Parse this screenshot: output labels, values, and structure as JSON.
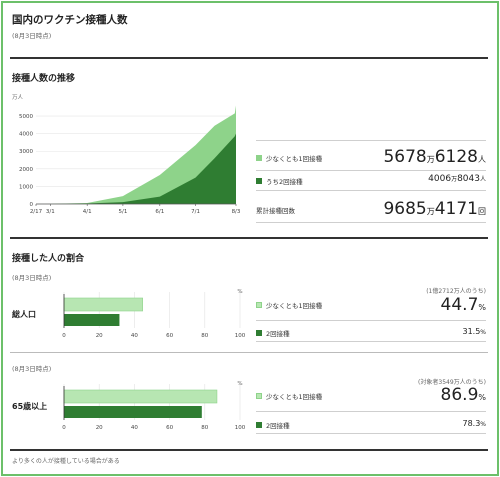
{
  "header": {
    "title": "国内のワクチン接種人数",
    "date": "(8月3日時点)"
  },
  "trend": {
    "title": "接種人数の推移",
    "y_unit": "万人",
    "at_least_one": {
      "label": "少なくとも1回接種",
      "num": "5678",
      "unit1": "万",
      "num2": "6128",
      "unit2": "人"
    },
    "second": {
      "label": "うち2回接種",
      "num": "4006",
      "unit1": "万",
      "num2": "8043",
      "unit2": "人"
    },
    "total": {
      "label": "累計接種回数",
      "num": "9685",
      "unit1": "万",
      "num2": "4171",
      "unit2": "回"
    }
  },
  "chart_data": {
    "type": "area",
    "x": [
      "2/17",
      "3/1",
      "4/1",
      "5/1",
      "6/1",
      "7/1",
      "8/3"
    ],
    "x_ticks": [
      "2/17",
      "3/1",
      "4/1",
      "5/1",
      "6/1",
      "7/1",
      "8/3"
    ],
    "y_ticks": [
      "5000",
      "4000",
      "3000",
      "2000",
      "1000",
      "0"
    ],
    "ylim": [
      0,
      5800
    ],
    "series": [
      {
        "name": "少なくとも1回接種",
        "color": "#8ed38a",
        "points": [
          [
            0,
            0
          ],
          [
            12,
            5
          ],
          [
            43,
            60
          ],
          [
            73,
            450
          ],
          [
            104,
            1650
          ],
          [
            134,
            3350
          ],
          [
            150,
            4450
          ],
          [
            167,
            5150
          ],
          [
            168,
            5600
          ]
        ]
      },
      {
        "name": "うち2回接種",
        "color": "#2f7d32",
        "points": [
          [
            0,
            0
          ],
          [
            12,
            1
          ],
          [
            43,
            25
          ],
          [
            73,
            110
          ],
          [
            104,
            420
          ],
          [
            134,
            1500
          ],
          [
            150,
            2600
          ],
          [
            167,
            3850
          ],
          [
            168,
            4010
          ]
        ]
      }
    ]
  },
  "share": {
    "title": "接種した人の割合",
    "groups": [
      {
        "date": "(8月3日時点)",
        "label": "総人口",
        "note": "(1億2712万人のうち)",
        "first_label": "少なくとも1回接種",
        "first_pct": "44.7",
        "second_label": "2回接種",
        "second_pct": "31.5",
        "pct_unit": "%",
        "first_value": 44.7,
        "second_value": 31.5
      },
      {
        "date": "(8月3日時点)",
        "label": "65歳以上",
        "note": "(対象者3549万人のうち)",
        "first_label": "少なくとも1回接種",
        "first_pct": "86.9",
        "second_label": "2回接種",
        "second_pct": "78.3",
        "pct_unit": "%",
        "first_value": 86.9,
        "second_value": 78.3
      }
    ],
    "axis_ticks": [
      "0",
      "20",
      "40",
      "60",
      "80",
      "100"
    ],
    "axis_unit": "%"
  },
  "footer": {
    "note": "より多くの人が接種している場合がある"
  },
  "colors": {
    "light": "#b7e6b2",
    "light_border": "#8ed38a",
    "dark": "#2f7d32",
    "frame": "#6cc06a"
  }
}
